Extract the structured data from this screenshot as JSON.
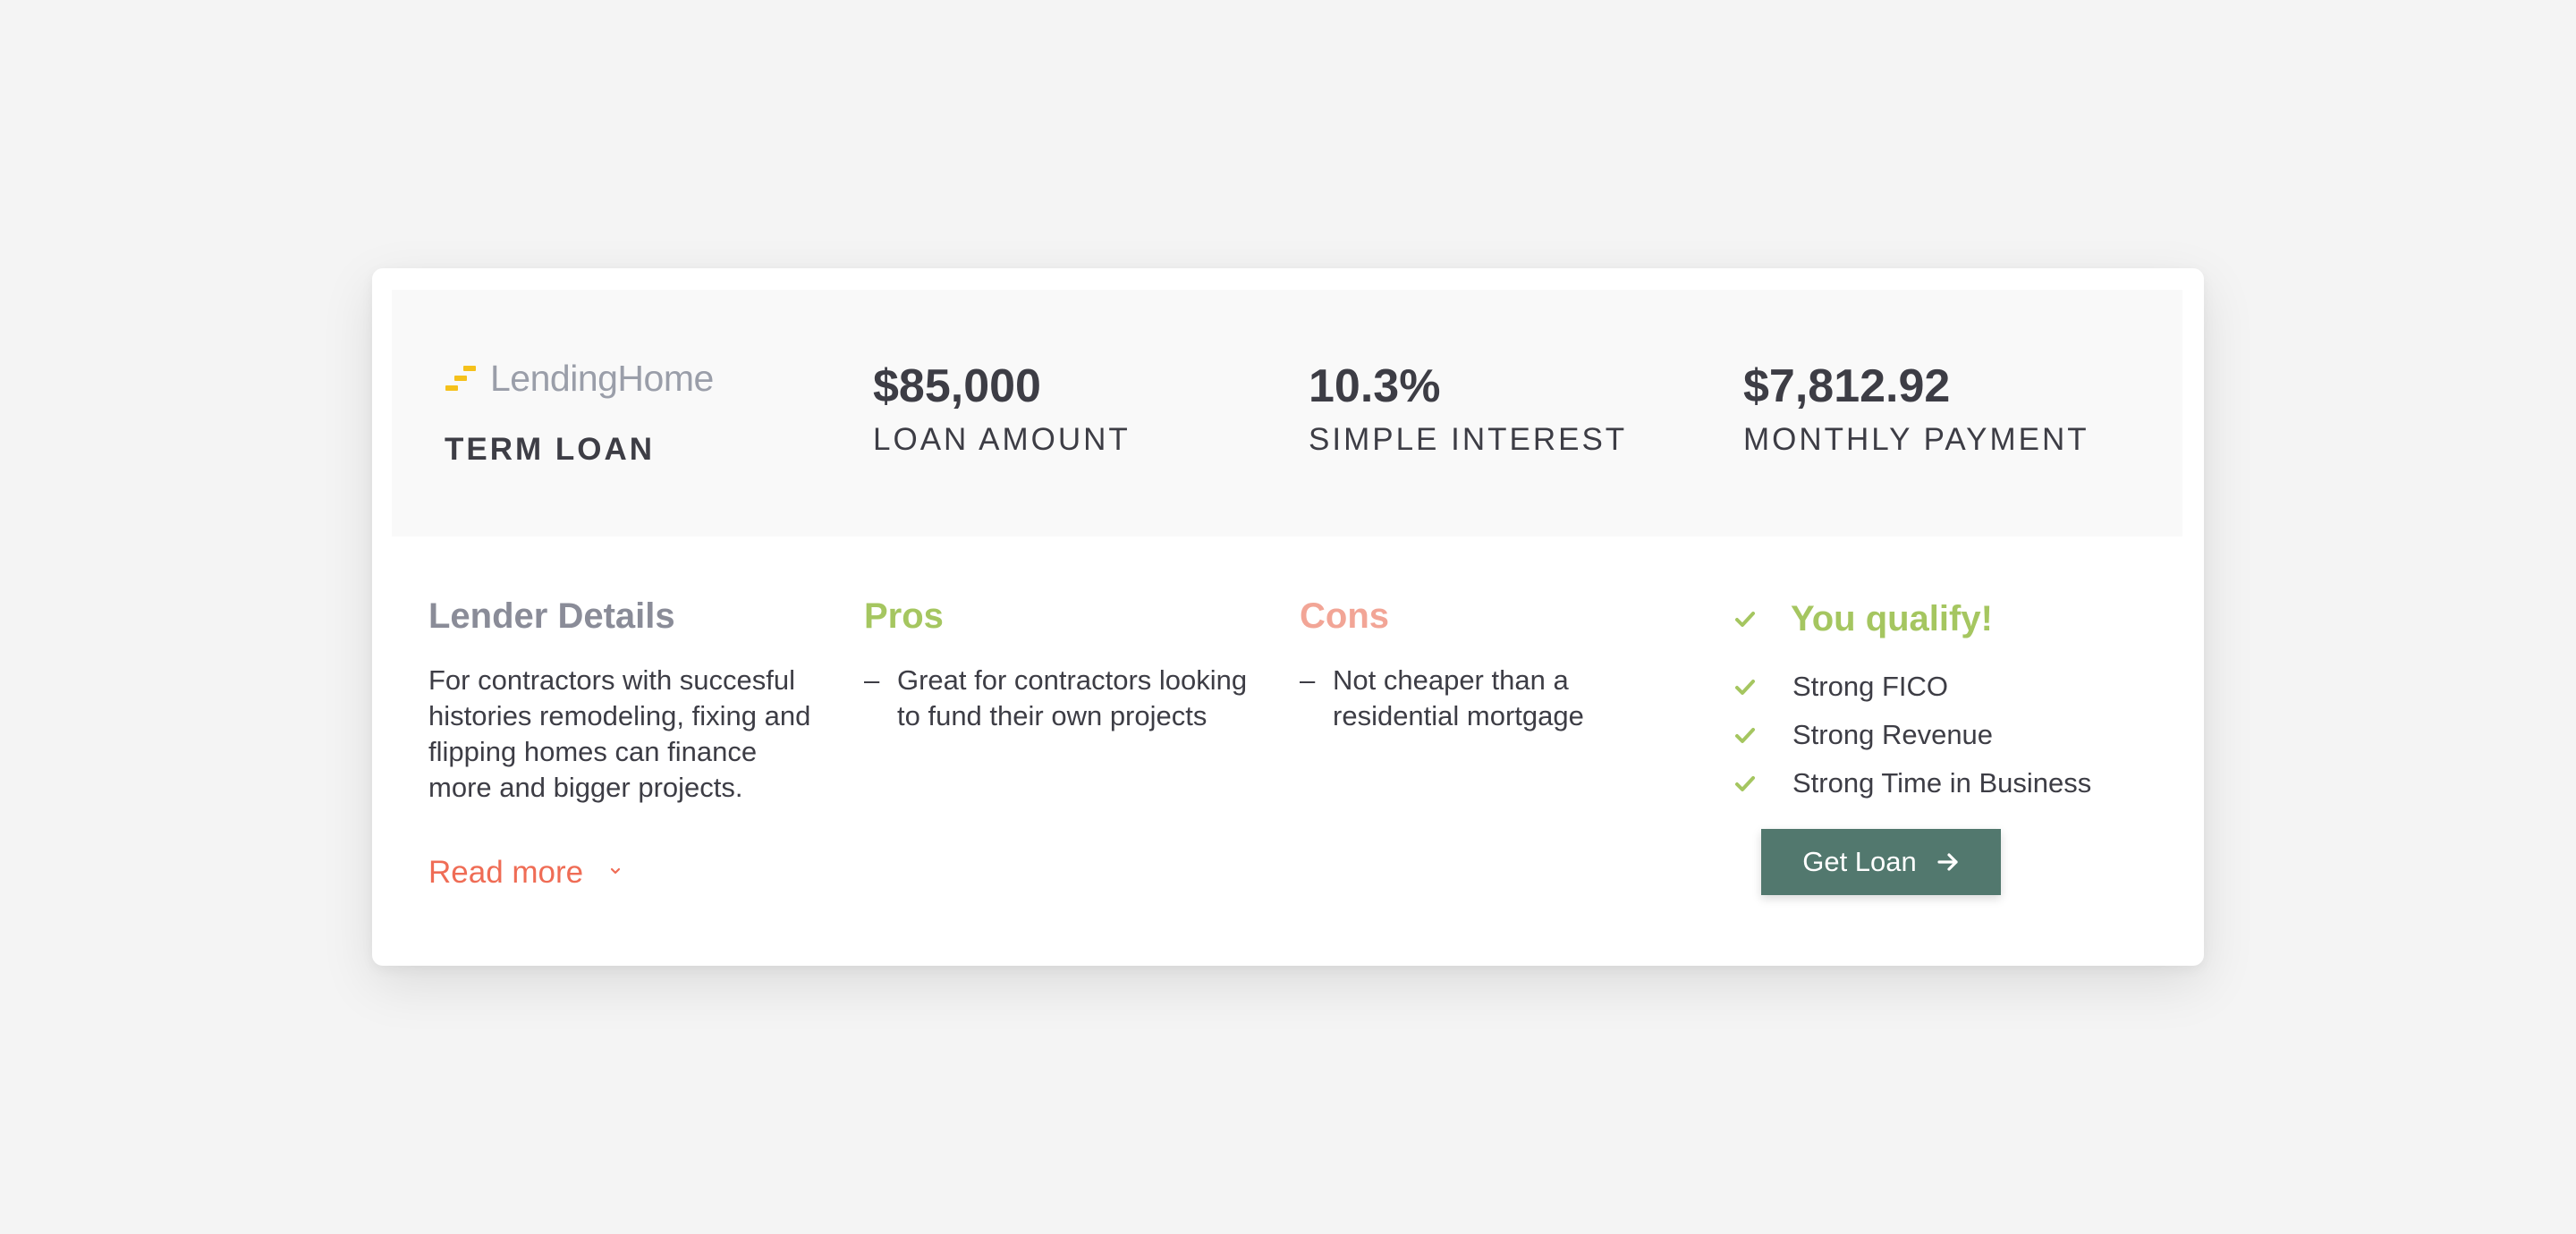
{
  "lender": {
    "name": "LendingHome",
    "loan_type": "TERM LOAN",
    "brand_color": "#f5c11b"
  },
  "stats": [
    {
      "value": "$85,000",
      "label": "LOAN AMOUNT"
    },
    {
      "value": "10.3%",
      "label": "SIMPLE INTEREST"
    },
    {
      "value": "$7,812.92",
      "label": "MONTHLY PAYMENT"
    }
  ],
  "details": {
    "title": "Lender Details",
    "description": "For contractors with succesful histories remodeling, fixing and flipping homes can finance more and bigger projects.",
    "read_more": "Read more"
  },
  "pros": {
    "title": "Pros",
    "items": [
      "Great for contractors looking to fund their own projects"
    ]
  },
  "cons": {
    "title": "Cons",
    "items": [
      "Not cheaper than a residential mortgage"
    ]
  },
  "qualify": {
    "title": "You qualify!",
    "items": [
      "Strong FICO",
      "Strong Revenue",
      "Strong Time in Business"
    ],
    "cta": "Get Loan"
  },
  "colors": {
    "accent_green": "#a5c660",
    "accent_red": "#ef6c55",
    "cons_pink": "#f2a596",
    "button_bg": "#52786e"
  },
  "icons": {
    "logo": "stairs-logo-icon",
    "read_more": "chevron-down-icon",
    "check": "check-icon",
    "cta": "arrow-right-icon"
  }
}
